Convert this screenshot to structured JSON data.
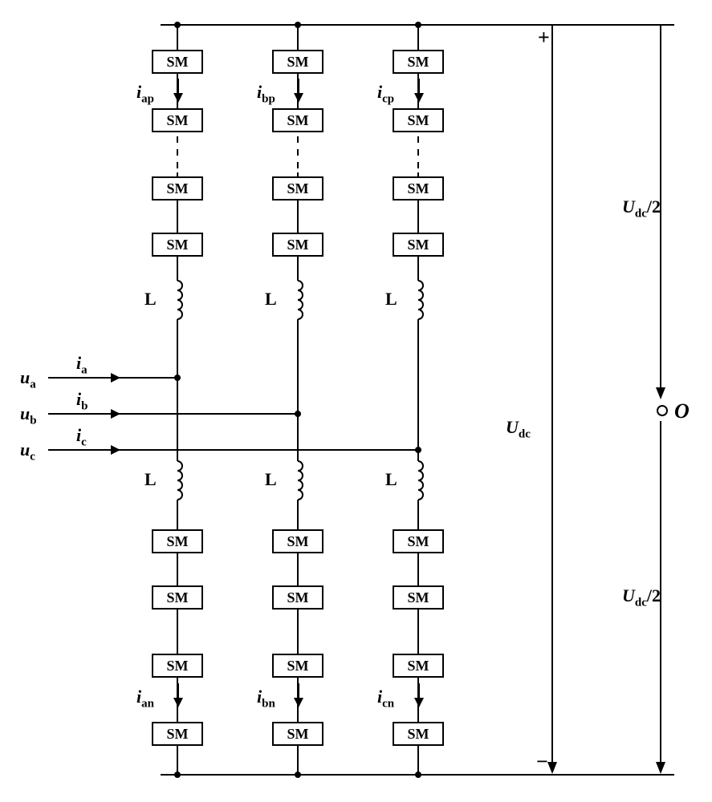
{
  "sm_label": "SM",
  "inductor_label": "L",
  "phase": {
    "a": "a",
    "b": "b",
    "c": "c"
  },
  "arm": {
    "p": "p",
    "n": "n"
  },
  "labels": {
    "ua": "u",
    "ub": "u",
    "uc": "u",
    "ia": "i",
    "ib": "i",
    "ic": "i",
    "Udc": "U",
    "Udc_half": "U",
    "origin": "O",
    "plus": "+",
    "minus": "−",
    "dc": "dc",
    "half": "/2"
  },
  "chart_data": {
    "type": "diagram",
    "description": "Three-phase Modular Multilevel Converter (MMC) topology",
    "phases": [
      "a",
      "b",
      "c"
    ],
    "arms_per_phase": 2,
    "arm_labels": [
      "upper (p)",
      "lower (n)"
    ],
    "submodules_per_arm_shown": 4,
    "arm_inductor": "L",
    "phase_voltages": [
      "u_a",
      "u_b",
      "u_c"
    ],
    "phase_currents": [
      "i_a",
      "i_b",
      "i_c"
    ],
    "upper_arm_currents": [
      "i_ap",
      "i_bp",
      "i_cp"
    ],
    "lower_arm_currents": [
      "i_an",
      "i_bn",
      "i_cn"
    ],
    "dc_bus_voltage": "U_dc",
    "dc_half": "U_dc/2",
    "dc_midpoint": "O"
  }
}
